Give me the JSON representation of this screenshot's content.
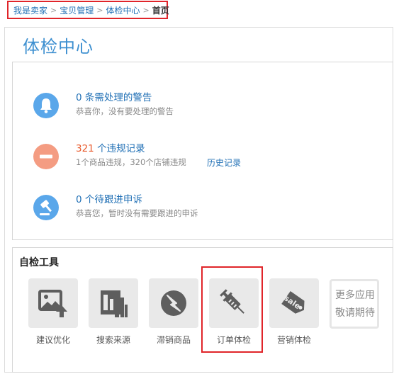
{
  "breadcrumb": {
    "items": [
      "我是卖家",
      "宝贝管理",
      "体检中心"
    ],
    "current": "首页",
    "separator": ">"
  },
  "page": {
    "title": "体检中心"
  },
  "stats": [
    {
      "count": "0",
      "label": "条需处理的警告",
      "sub": "恭喜你，没有要处理的警告",
      "icon": "bell-icon",
      "color": "#5aa7ea"
    },
    {
      "count": "321",
      "label": "个违规记录",
      "sub": "1个商品违规，320个店铺违规",
      "link": "历史记录",
      "icon": "minus-icon",
      "color": "#f49c82"
    },
    {
      "count": "0",
      "label": "个待跟进申诉",
      "sub": "恭喜您，暂时没有需要跟进的申诉",
      "icon": "gavel-icon",
      "color": "#5aa7ea"
    }
  ],
  "tools": {
    "title": "自检工具",
    "items": [
      {
        "label": "建议优化",
        "icon": "image-upload-icon"
      },
      {
        "label": "搜索来源",
        "icon": "bar-chart-icon"
      },
      {
        "label": "滞销商品",
        "icon": "lightning-circle-icon"
      },
      {
        "label": "订单体检",
        "icon": "syringe-icon"
      },
      {
        "label": "营销体检",
        "icon": "sale-tag-icon"
      }
    ],
    "more_line1": "更多应用",
    "more_line2": "敬请期待",
    "sale_text": "sale"
  },
  "colors": {
    "accent": "#3d8fd0",
    "link": "#1f6fb5",
    "alert": "#e85a2c",
    "highlight": "#e0252a"
  }
}
